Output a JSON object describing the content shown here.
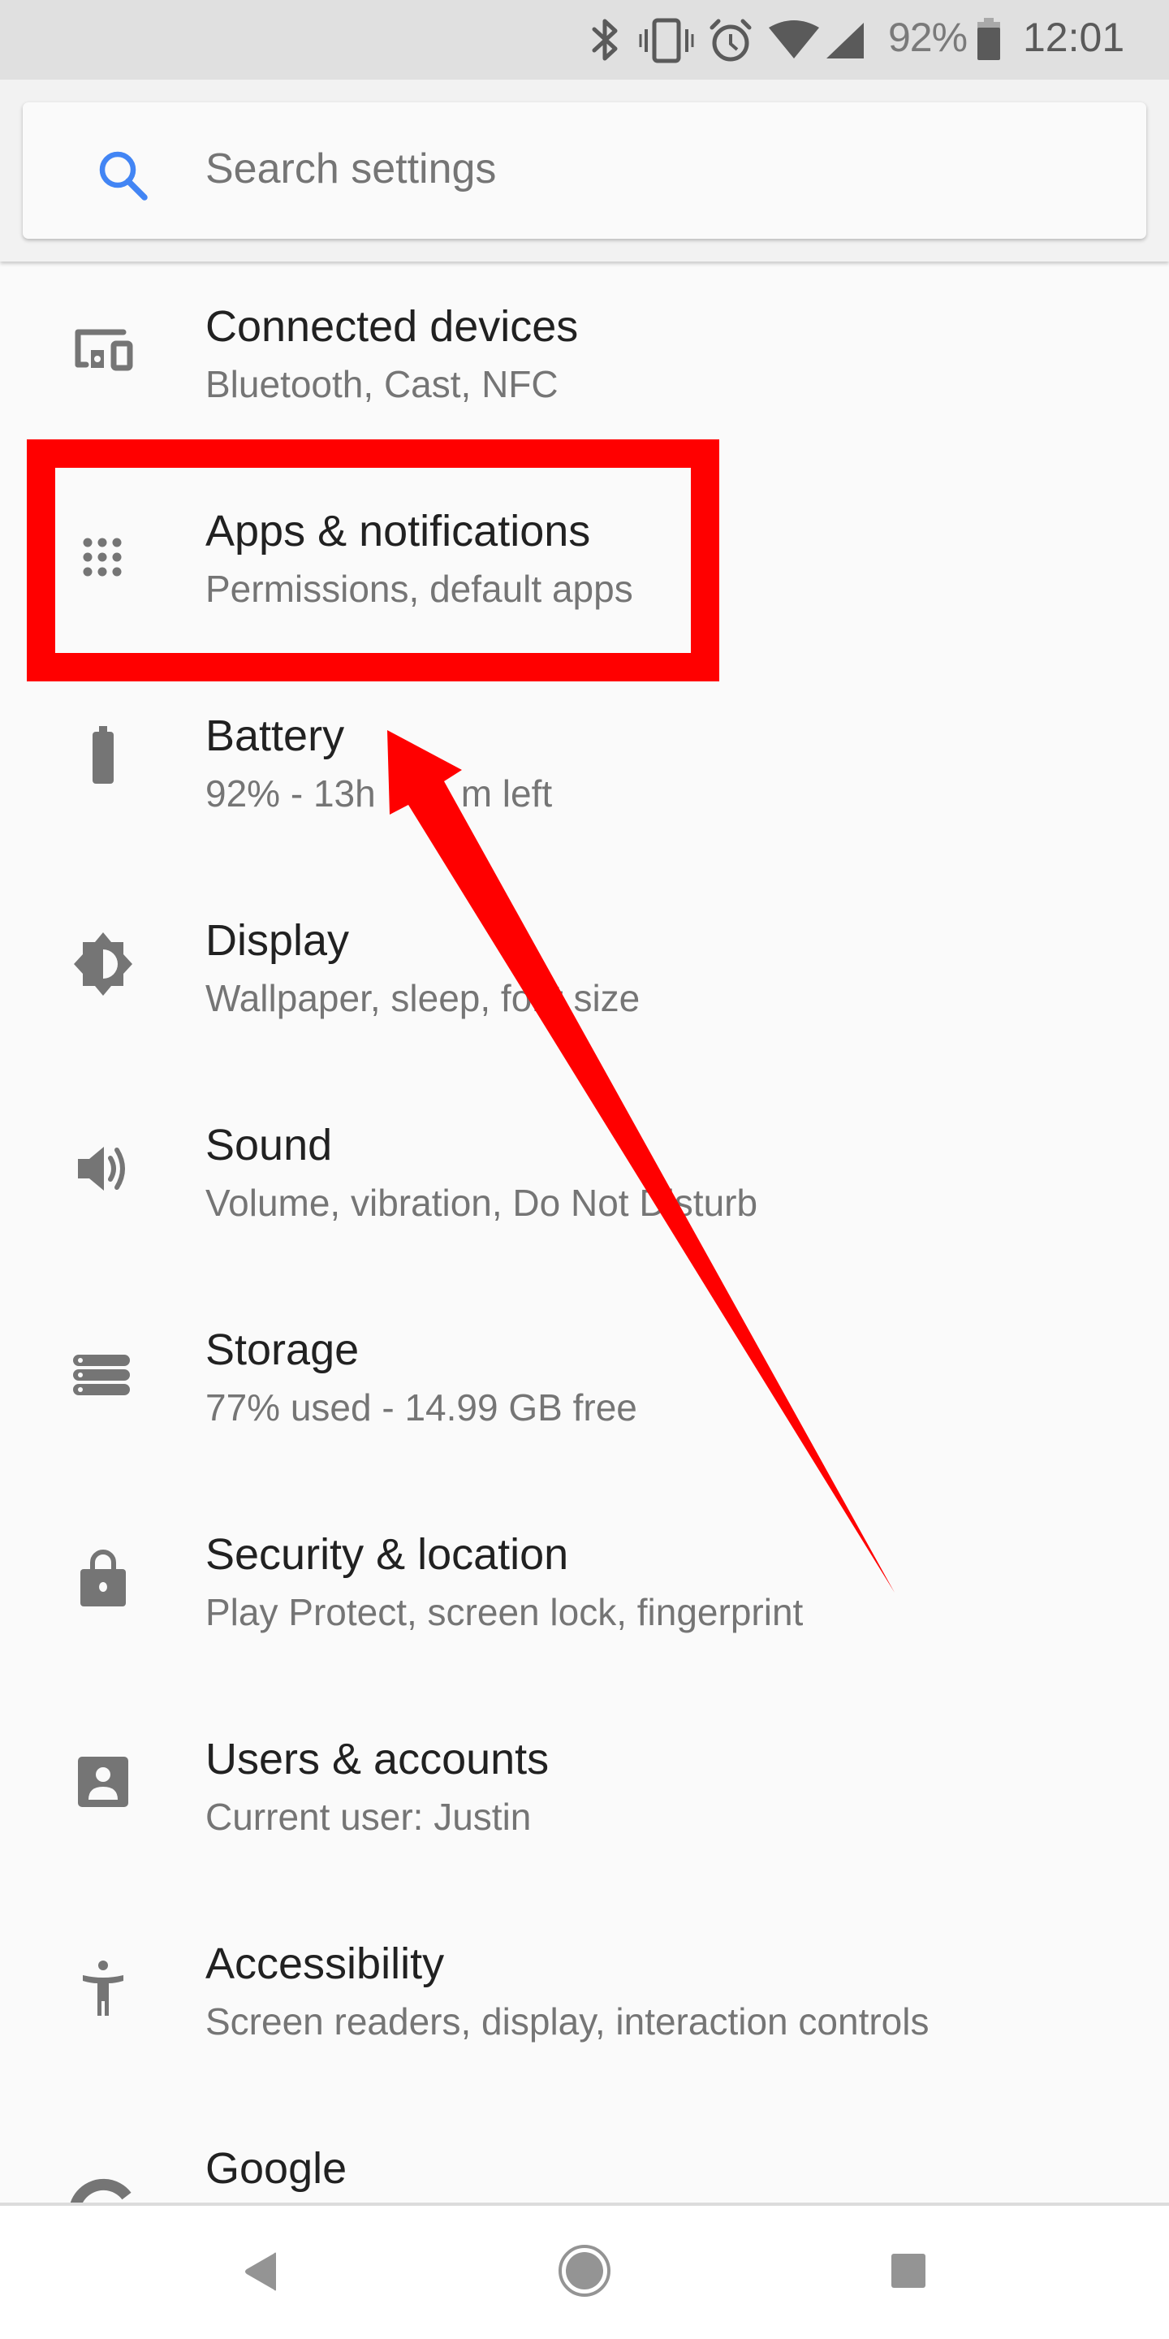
{
  "status_bar": {
    "icons": [
      "bluetooth-icon",
      "vibrate-icon",
      "alarm-icon",
      "wifi-icon",
      "cell-signal-icon",
      "battery-icon"
    ],
    "battery_percent": "92%",
    "time": "12:01"
  },
  "search": {
    "placeholder": "Search settings",
    "icon": "search-icon",
    "accent_color": "#4285f4"
  },
  "settings": [
    {
      "id": "connected-devices",
      "icon": "devices-icon",
      "title": "Connected devices",
      "subtitle": "Bluetooth, Cast, NFC"
    },
    {
      "id": "apps-notifications",
      "icon": "apps-grid-icon",
      "title": "Apps & notifications",
      "subtitle": "Permissions, default apps"
    },
    {
      "id": "battery",
      "icon": "battery-icon",
      "title": "Battery",
      "subtitle_visible_start": "92% - 13h",
      "subtitle_visible_end": "m left"
    },
    {
      "id": "display",
      "icon": "brightness-icon",
      "title": "Display",
      "subtitle": "Wallpaper, sleep, font size"
    },
    {
      "id": "sound",
      "icon": "volume-icon",
      "title": "Sound",
      "subtitle": "Volume, vibration, Do Not Disturb"
    },
    {
      "id": "storage",
      "icon": "storage-icon",
      "title": "Storage",
      "subtitle": "77% used - 14.99 GB free"
    },
    {
      "id": "security-location",
      "icon": "lock-icon",
      "title": "Security & location",
      "subtitle": "Play Protect, screen lock, fingerprint"
    },
    {
      "id": "users-accounts",
      "icon": "account-icon",
      "title": "Users & accounts",
      "subtitle": "Current user: Justin"
    },
    {
      "id": "accessibility",
      "icon": "accessibility-icon",
      "title": "Accessibility",
      "subtitle": "Screen readers, display, interaction controls"
    },
    {
      "id": "google",
      "icon": "google-icon",
      "title": "Google"
    }
  ],
  "annotation": {
    "highlighted_item": "Apps & notifications",
    "color": "#ff0000"
  },
  "nav_bar": {
    "buttons": [
      "back-icon",
      "home-icon",
      "recents-icon"
    ]
  }
}
